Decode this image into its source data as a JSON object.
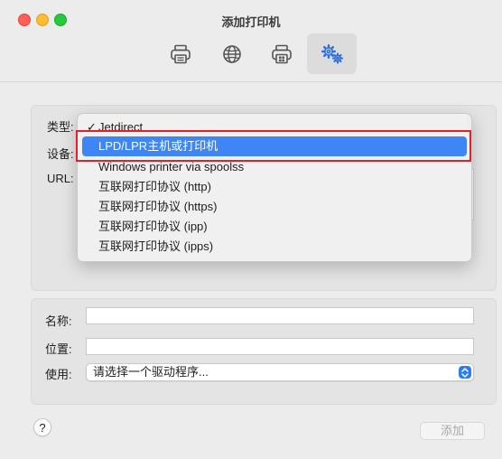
{
  "window": {
    "title": "添加打印机"
  },
  "toolbar": {
    "items": [
      {
        "icon": "printer-icon",
        "active": false
      },
      {
        "icon": "globe-icon",
        "active": false
      },
      {
        "icon": "windows-printer-icon",
        "active": false
      },
      {
        "icon": "gear-icon",
        "active": true
      }
    ]
  },
  "form_top": {
    "type_label": "类型:",
    "device_label": "设备:",
    "url_label": "URL:"
  },
  "type_menu": {
    "options": [
      {
        "label": "Jetdirect",
        "checked": true,
        "highlighted": false
      },
      {
        "label": "LPD/LPR主机或打印机",
        "checked": false,
        "highlighted": true
      },
      {
        "label": "Windows printer via spoolss",
        "checked": false,
        "highlighted": false
      },
      {
        "label": "互联网打印协议 (http)",
        "checked": false,
        "highlighted": false
      },
      {
        "label": "互联网打印协议 (https)",
        "checked": false,
        "highlighted": false
      },
      {
        "label": "互联网打印协议 (ipp)",
        "checked": false,
        "highlighted": false
      },
      {
        "label": "互联网打印协议 (ipps)",
        "checked": false,
        "highlighted": false
      }
    ],
    "check_mark": "✓"
  },
  "form_bottom": {
    "name_label": "名称:",
    "name_value": "",
    "location_label": "位置:",
    "location_value": "",
    "use_label": "使用:",
    "use_value": "请选择一个驱动程序..."
  },
  "buttons": {
    "help": "?",
    "add": "添加"
  },
  "colors": {
    "accent": "#3e86f5",
    "highlight_box": "#e0202a"
  }
}
